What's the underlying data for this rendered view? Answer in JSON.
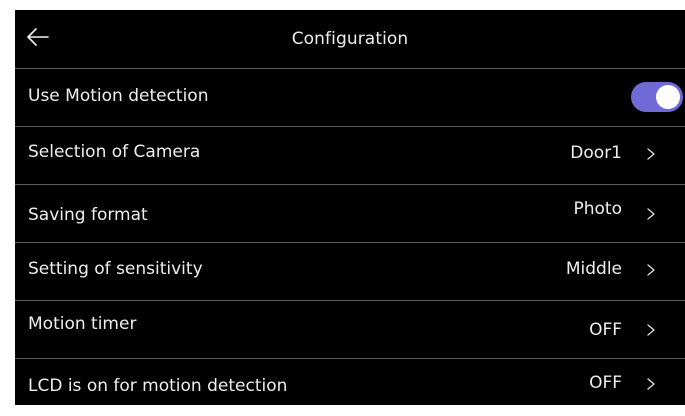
{
  "header": {
    "title": "Configuration",
    "back_icon": "back-arrow-icon"
  },
  "settings": [
    {
      "label": "Use Motion detection",
      "type": "toggle",
      "enabled": true,
      "accent_color": "#6f6ad6"
    },
    {
      "label": "Selection of Camera",
      "type": "select",
      "value": "Door1"
    },
    {
      "label": "Saving format",
      "type": "select",
      "value": "Photo"
    },
    {
      "label": "Setting of sensitivity",
      "type": "select",
      "value": "Middle"
    },
    {
      "label": "Motion timer",
      "type": "select",
      "value": "OFF"
    },
    {
      "label": "LCD is on for motion detection",
      "type": "select",
      "value": "OFF"
    }
  ]
}
